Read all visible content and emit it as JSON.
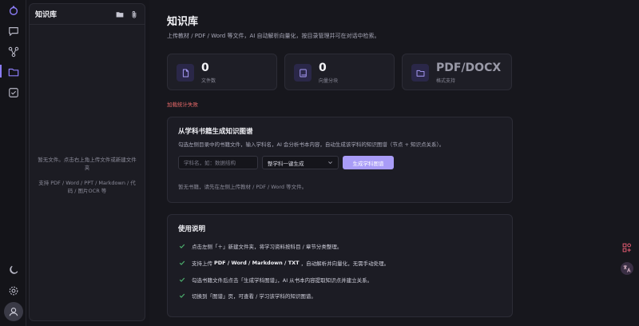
{
  "colors": {
    "accent": "#8b7cf6",
    "error": "#e86a6a",
    "check": "#4caf6e"
  },
  "sidebar": {
    "title": "知识库",
    "empty_line1": "暂无文件。点击右上角上传文件或新建文件夹",
    "empty_line2": "支持 PDF / Word / PPT / Markdown / 代码 / 图片OCR 等"
  },
  "main": {
    "title": "知识库",
    "description": "上传教材 / PDF / Word 等文件，AI 自动解析向量化，按目录管理并可在对话中检索。",
    "stats": [
      {
        "value": "0",
        "label": "文件数",
        "icon": "file-icon"
      },
      {
        "value": "0",
        "label": "向量分块",
        "icon": "book-icon"
      },
      {
        "value": "PDF/DOCX",
        "label": "格式支持",
        "icon": "folder-icon"
      }
    ],
    "error": "加载统计失败",
    "graph_card": {
      "title": "从学科书籍生成知识图谱",
      "description": "勾选左侧目录中的书籍文件，输入学科名，AI 会分析书本内容，自动生成该学科的知识图谱（节点 + 知识点关系）。",
      "input_placeholder": "学科名，如：数据结构",
      "select_value": "整学科一键生成",
      "button_label": "生成学科图谱",
      "note": "暂无书籍，请先在左侧上传教材 / PDF / Word 等文件。"
    },
    "usage_card": {
      "title": "使用说明",
      "items": [
        {
          "pre": "点击左侧「＋」新建文件夹，将学习资料按科目 / 章节分类整理。",
          "bold": "",
          "post": ""
        },
        {
          "pre": "支持上传",
          "bold": "PDF / Word / Markdown / TXT",
          "post": "，自动解析并向量化，无需手动处理。"
        },
        {
          "pre": "勾选书籍文件后点击「生成学科图谱」，AI 从书本内容提取知识点并建立关系。",
          "bold": "",
          "post": ""
        },
        {
          "pre": "切换到「图谱」页，可查看 / 学习该学科的知识图谱。",
          "bold": "",
          "post": ""
        }
      ]
    }
  }
}
